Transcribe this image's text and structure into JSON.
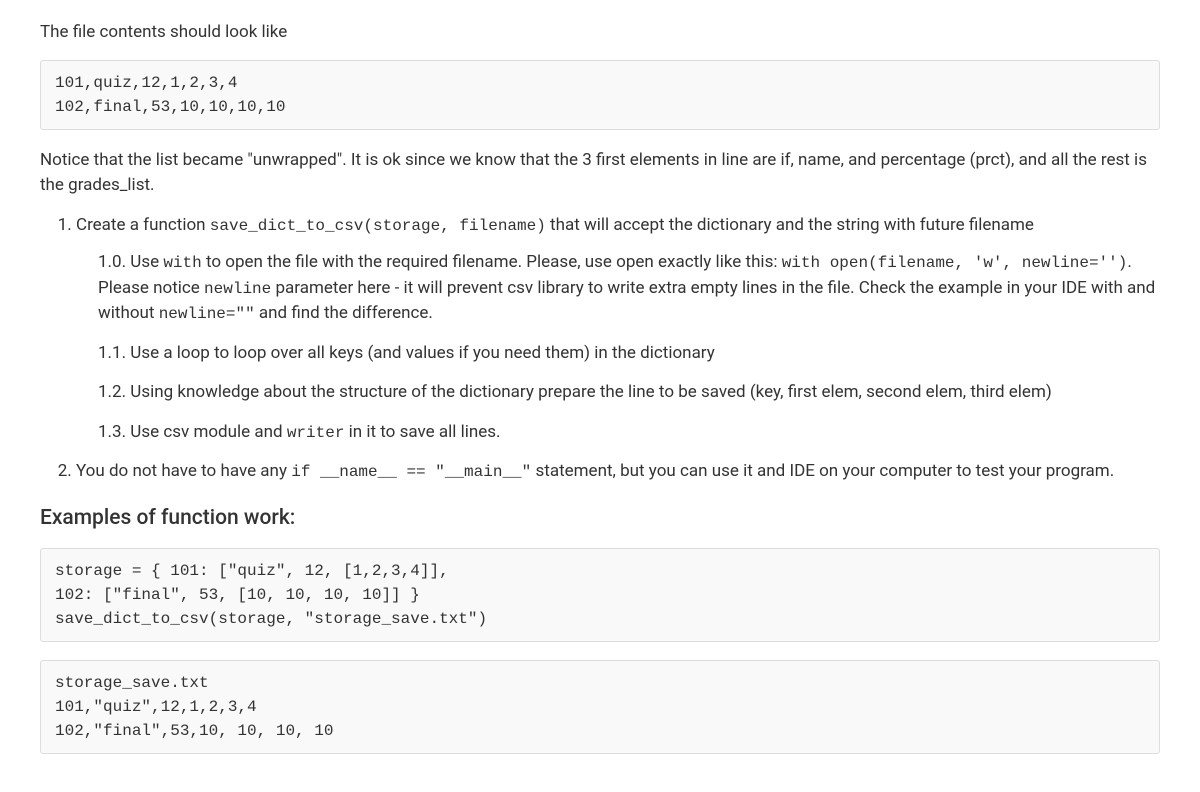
{
  "intro": "The file contents should look like",
  "code1": "101,quiz,12,1,2,3,4\n102,final,53,10,10,10,10",
  "notice_pre": "Notice that the list became \"unwrapped\". It is ok since we know that the 3 first elements in line are if, name, and percentage (prct), and all the rest is the grades_list.",
  "li1_pre": "Create a function ",
  "li1_code": "save_dict_to_csv(storage, filename)",
  "li1_post": " that will accept the dictionary and the string with future filename",
  "s10_a": "1.0. Use ",
  "s10_code1": "with",
  "s10_b": " to open the file with the required filename. Please, use open exactly like this: ",
  "s10_code2": "with open(filename, 'w', newline='')",
  "s10_c": ". Please notice ",
  "s10_code3": "newline",
  "s10_d": " parameter here - it will prevent csv library to write extra empty lines in the file. Check the example in your IDE with and without ",
  "s10_code4": "newline=\"\"",
  "s10_e": " and find the difference.",
  "s11": "1.1. Use a loop to loop over all keys (and values if you need them) in the dictionary",
  "s12": "1.2. Using knowledge about the structure of the dictionary prepare the line to be saved (key, first elem, second elem, third elem)",
  "s13_a": "1.3. Use csv module and ",
  "s13_code": "writer",
  "s13_b": " in it to save all lines.",
  "li2_a": "You do not have to have any ",
  "li2_code": "if __name__ == \"__main__\"",
  "li2_b": " statement, but you can use it and IDE on your computer to test your program.",
  "examples_heading": "Examples of function work:",
  "code2": "storage = { 101: [\"quiz\", 12, [1,2,3,4]],\n102: [\"final\", 53, [10, 10, 10, 10]] }\nsave_dict_to_csv(storage, \"storage_save.txt\")",
  "code3": "storage_save.txt\n101,\"quiz\",12,1,2,3,4\n102,\"final\",53,10, 10, 10, 10"
}
